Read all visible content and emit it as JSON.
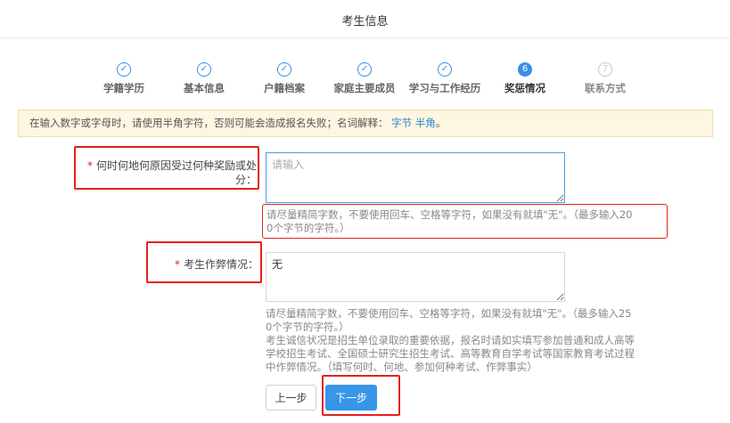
{
  "header": {
    "title": "考生信息"
  },
  "steps": [
    {
      "label": "学籍学历",
      "state": "done",
      "mark": "✓"
    },
    {
      "label": "基本信息",
      "state": "done",
      "mark": "✓"
    },
    {
      "label": "户籍档案",
      "state": "done",
      "mark": "✓"
    },
    {
      "label": "家庭主要成员",
      "state": "done",
      "mark": "✓"
    },
    {
      "label": "学习与工作经历",
      "state": "done",
      "mark": "✓"
    },
    {
      "label": "奖惩情况",
      "state": "active",
      "mark": "6"
    },
    {
      "label": "联系方式",
      "state": "todo",
      "mark": "7"
    }
  ],
  "notice": {
    "text": "在输入数字或字母时，请使用半角字符，否则可能会造成报名失败；名词解释：",
    "link1": "字节",
    "link2": "半角",
    "suffix": "。"
  },
  "form": {
    "awards": {
      "required_mark": "*",
      "label_line1": "何时何地何原因受过何种奖励或处",
      "label_line2": "分：",
      "value": "",
      "placeholder": "请输入",
      "hint_line1": "请尽量精简字数，不要使用回车、空格等字符，如果没有就填\"无\"。（最多输入20",
      "hint_line2": "0个字节的字符。）"
    },
    "cheating": {
      "required_mark": "*",
      "label": "考生作弊情况：",
      "value": "无",
      "hint_lines": [
        "请尽量精简字数，不要使用回车、空格等字符，如果没有就填\"无\"。（最多输入25",
        "0个字节的字符。）",
        "考生诚信状况是招生单位录取的重要依据，报名时请如实填写参加普通和成人高等",
        "学校招生考试、全国硕士研究生招生考试、高等教育自学考试等国家教育考试过程",
        "中作弊情况。（填写何时、何地、参加何种考试、作弊事实）"
      ]
    }
  },
  "buttons": {
    "prev": "上一步",
    "next": "下一步"
  },
  "colors": {
    "accent": "#3a8ee6",
    "highlight": "#e3221c",
    "notice_bg": "#fdf6e0"
  }
}
